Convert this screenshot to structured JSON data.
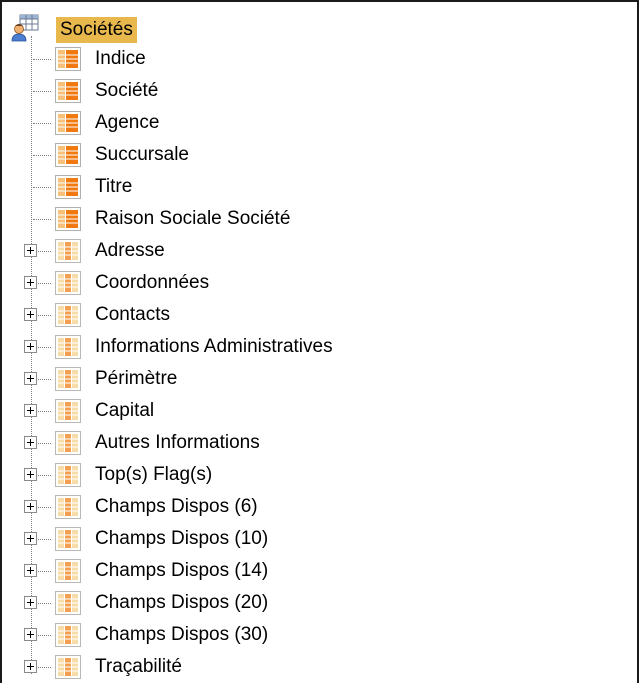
{
  "tree": {
    "root": {
      "label": "Sociétés",
      "icon": "table-icon"
    },
    "items": [
      {
        "label": "Indice",
        "icon": "field-icon",
        "expandable": false
      },
      {
        "label": "Société",
        "icon": "field-icon",
        "expandable": false
      },
      {
        "label": "Agence",
        "icon": "field-icon",
        "expandable": false
      },
      {
        "label": "Succursale",
        "icon": "field-icon",
        "expandable": false
      },
      {
        "label": "Titre",
        "icon": "field-icon",
        "expandable": false
      },
      {
        "label": "Raison Sociale Société",
        "icon": "field-icon",
        "expandable": false
      },
      {
        "label": "Adresse",
        "icon": "group-icon",
        "expandable": true
      },
      {
        "label": "Coordonnées",
        "icon": "group-icon",
        "expandable": true
      },
      {
        "label": "Contacts",
        "icon": "group-icon",
        "expandable": true
      },
      {
        "label": "Informations Administratives",
        "icon": "group-icon",
        "expandable": true
      },
      {
        "label": "Périmètre",
        "icon": "group-icon",
        "expandable": true
      },
      {
        "label": "Capital",
        "icon": "group-icon",
        "expandable": true
      },
      {
        "label": "Autres Informations",
        "icon": "group-icon",
        "expandable": true
      },
      {
        "label": "Top(s) Flag(s)",
        "icon": "group-icon",
        "expandable": true
      },
      {
        "label": "Champs Dispos (6)",
        "icon": "group-icon",
        "expandable": true
      },
      {
        "label": "Champs Dispos (10)",
        "icon": "group-icon",
        "expandable": true
      },
      {
        "label": "Champs Dispos (14)",
        "icon": "group-icon",
        "expandable": true
      },
      {
        "label": "Champs Dispos (20)",
        "icon": "group-icon",
        "expandable": true
      },
      {
        "label": "Champs Dispos (30)",
        "icon": "group-icon",
        "expandable": true
      },
      {
        "label": "Traçabilité",
        "icon": "group-icon",
        "expandable": true
      }
    ]
  },
  "colors": {
    "selection": "#e8b84d",
    "field_icon_orange": "#f07a10",
    "field_icon_light": "#f6c07a",
    "group_icon_orange": "#f2a050",
    "group_icon_light": "#f8dca8"
  }
}
